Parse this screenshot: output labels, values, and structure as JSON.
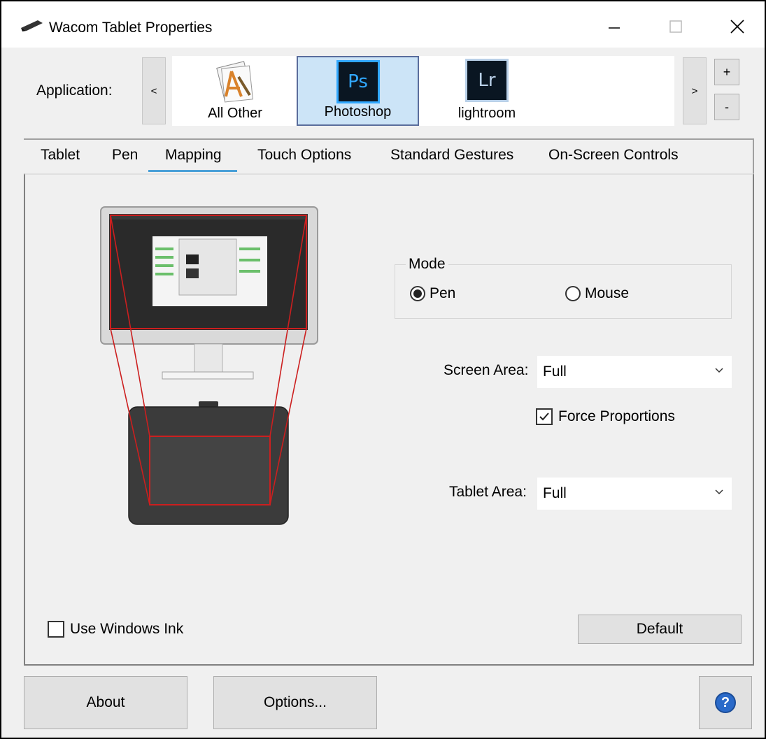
{
  "window": {
    "title": "Wacom Tablet Properties",
    "controls": {
      "minimize": "minimize-icon",
      "maximize": "maximize-icon",
      "close": "close-icon"
    }
  },
  "application": {
    "label": "Application:",
    "scroll_left": "<",
    "scroll_right": ">",
    "add": "+",
    "remove": "-",
    "items": [
      {
        "label": "All Other",
        "icon": "all-other-icon",
        "selected": false
      },
      {
        "label": "Photoshop",
        "icon_text": "Ps",
        "selected": true
      },
      {
        "label": "lightroom",
        "icon_text": "Lr",
        "selected": false
      }
    ]
  },
  "tabs": [
    {
      "label": "Tablet",
      "active": false
    },
    {
      "label": "Pen",
      "active": false
    },
    {
      "label": "Mapping",
      "active": true
    },
    {
      "label": "Touch Options",
      "active": false
    },
    {
      "label": "Standard Gestures",
      "active": false
    },
    {
      "label": "On-Screen Controls",
      "active": false
    }
  ],
  "mapping": {
    "mode": {
      "legend": "Mode",
      "options": [
        {
          "label": "Pen",
          "checked": true
        },
        {
          "label": "Mouse",
          "checked": false
        }
      ]
    },
    "screen_area": {
      "label": "Screen Area:",
      "value": "Full"
    },
    "force_proportions": {
      "label": "Force Proportions",
      "checked": true
    },
    "tablet_area": {
      "label": "Tablet Area:",
      "value": "Full"
    },
    "use_windows_ink": {
      "label": "Use Windows Ink",
      "checked": false
    },
    "default_button": "Default"
  },
  "footer": {
    "about": "About",
    "options": "Options...",
    "help": "?"
  },
  "colors": {
    "tab_underline": "#4aa0d8",
    "selected_app_bg": "#cce4f7",
    "mapping_outline": "#cc1f1f",
    "help_blue": "#2a6ac9"
  }
}
